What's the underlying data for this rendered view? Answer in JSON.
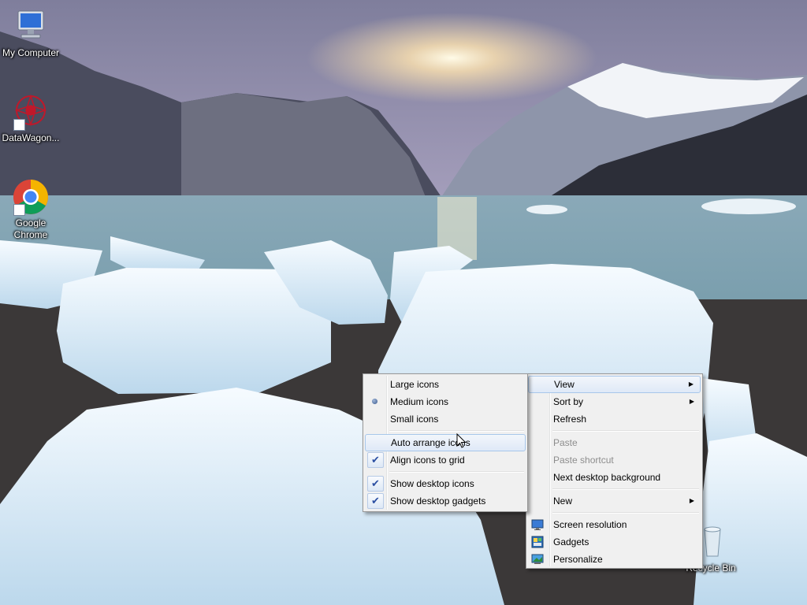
{
  "desktop": {
    "icons": [
      {
        "label": "My Computer",
        "icon": "computer-icon"
      },
      {
        "label": "DataWagon...",
        "icon": "datawagon-icon"
      },
      {
        "label": "Google Chrome",
        "icon": "chrome-icon"
      },
      {
        "label": "Recycle Bin",
        "icon": "recycle-bin-icon"
      }
    ]
  },
  "context_menu": {
    "items": [
      {
        "label": "View",
        "has_submenu": true,
        "highlighted": true
      },
      {
        "label": "Sort by",
        "has_submenu": true
      },
      {
        "label": "Refresh"
      },
      {
        "label": "Paste",
        "disabled": true
      },
      {
        "label": "Paste shortcut",
        "disabled": true
      },
      {
        "label": "Next desktop background"
      },
      {
        "label": "New",
        "has_submenu": true
      },
      {
        "label": "Screen resolution",
        "icon": "screen-resolution-icon"
      },
      {
        "label": "Gadgets",
        "icon": "gadgets-icon"
      },
      {
        "label": "Personalize",
        "icon": "personalize-icon"
      }
    ]
  },
  "view_submenu": {
    "items": [
      {
        "label": "Large icons"
      },
      {
        "label": "Medium icons",
        "selected": true
      },
      {
        "label": "Small icons"
      },
      {
        "label": "Auto arrange icons",
        "hovered": true
      },
      {
        "label": "Align icons to grid",
        "checked": true
      },
      {
        "label": "Show desktop icons",
        "checked": true
      },
      {
        "label": "Show desktop gadgets",
        "checked": true
      }
    ]
  },
  "colors": {
    "menu_bg": "#f0f0f0",
    "highlight_border": "#a8c7ea",
    "check_color": "#2b4fa3"
  }
}
